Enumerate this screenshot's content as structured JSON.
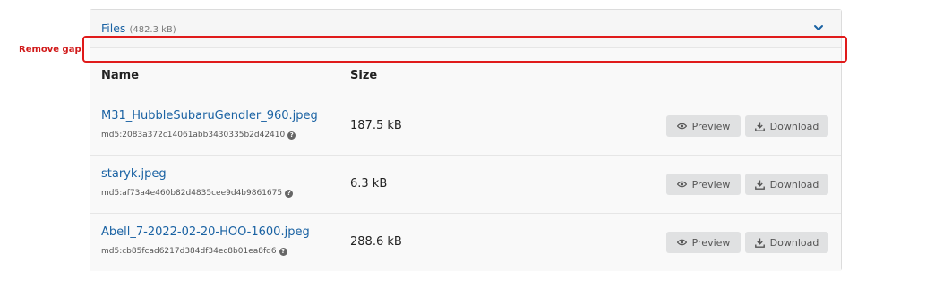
{
  "annotation": {
    "label": "Remove gap",
    "color": "#e01b1b"
  },
  "files_panel": {
    "title": "Files",
    "total_size": "(482.3 kB)",
    "toggle_icon": "chevron-down-icon",
    "columns": {
      "name": "Name",
      "size": "Size"
    },
    "files": [
      {
        "name": "M31_HubbleSubaruGendler_960.jpeg",
        "md5": "md5:2083a372c14061abb3430335b2d42410",
        "size": "187.5 kB",
        "preview_label": "Preview",
        "download_label": "Download"
      },
      {
        "name": "staryk.jpeg",
        "md5": "md5:af73a4e460b82d4835cee9d4b9861675",
        "size": "6.3 kB",
        "preview_label": "Preview",
        "download_label": "Download"
      },
      {
        "name": "Abell_7-2022-02-20-HOO-1600.jpeg",
        "md5": "md5:cb85fcad6217d384df34ec8b01ea8fd6",
        "size": "288.6 kB",
        "preview_label": "Preview",
        "download_label": "Download"
      }
    ]
  },
  "colors": {
    "link": "#1a62a3",
    "button_bg": "#e0e1e2"
  }
}
